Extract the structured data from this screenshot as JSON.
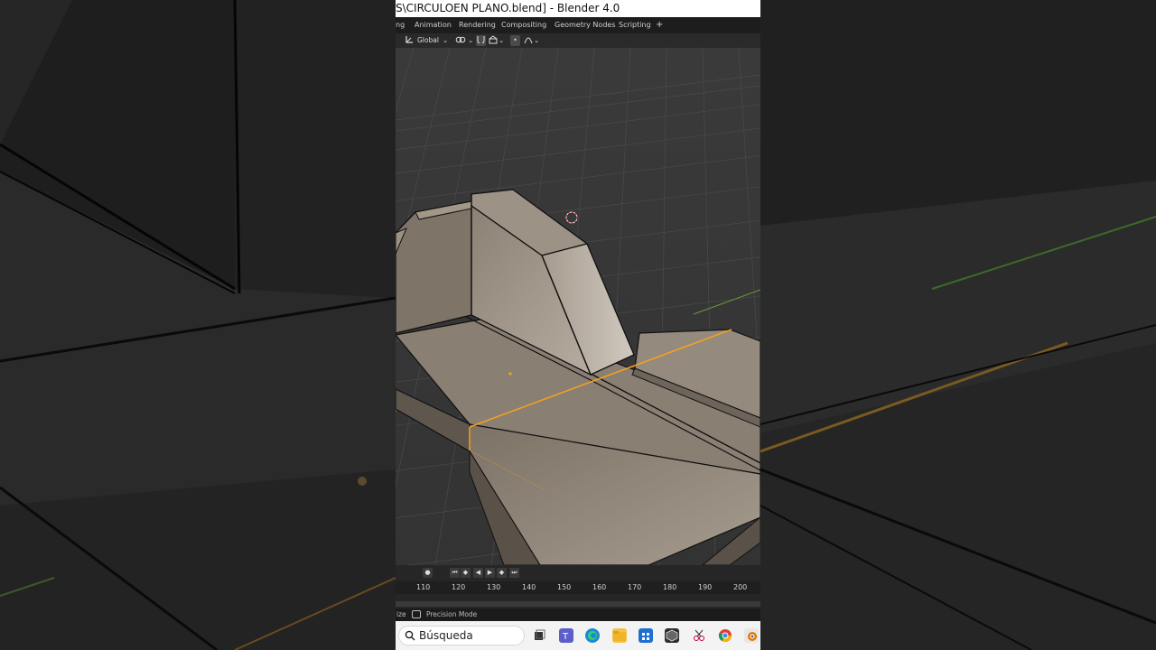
{
  "window": {
    "title": "S\\CIRCULOEN PLANO.blend] - Blender 4.0"
  },
  "workspace_tabs": [
    "ng",
    "Animation",
    "Rendering",
    "Compositing",
    "Geometry Nodes",
    "Scripting",
    "+"
  ],
  "header": {
    "orientation_label": "Global"
  },
  "timeline": {
    "frame_labels": [
      "110",
      "120",
      "130",
      "140",
      "150",
      "160",
      "170",
      "180",
      "190",
      "200"
    ]
  },
  "statusbar": {
    "left_label": "ize",
    "mode_label": "Precision Mode"
  },
  "taskbar": {
    "search_placeholder": "Búsqueda"
  },
  "colors": {
    "selection": "#f5a020",
    "mesh_face": "#8a7e72",
    "grid_green": "#6a9a3a"
  }
}
